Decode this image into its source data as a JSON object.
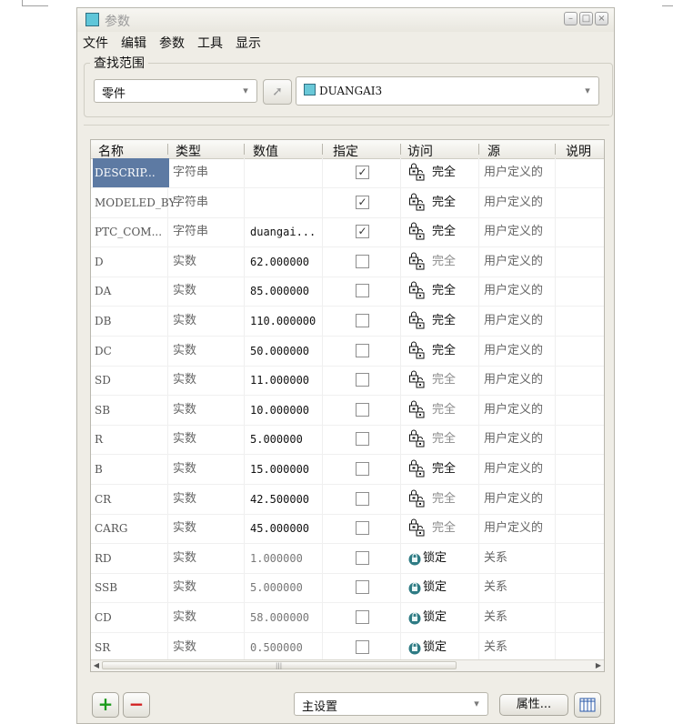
{
  "window": {
    "title": "参数",
    "titlebar_buttons": [
      "minimize",
      "maximize",
      "close"
    ]
  },
  "menu": [
    "文件",
    "编辑",
    "参数",
    "工具",
    "显示"
  ],
  "lookup": {
    "label": "查找范围",
    "scope": "零件",
    "model": "DUANGAI3"
  },
  "table": {
    "headers": [
      "名称",
      "类型",
      "数值",
      "指定",
      "访问",
      "源",
      "说明"
    ],
    "rows": [
      {
        "name": "DESCRIP...",
        "type": "字符串",
        "value": "",
        "designated": true,
        "access": "完全",
        "access_kind": "full",
        "source": "用户定义的",
        "selected": true
      },
      {
        "name": "MODELED_BY",
        "type": "字符串",
        "value": "",
        "designated": true,
        "access": "完全",
        "access_kind": "full",
        "source": "用户定义的"
      },
      {
        "name": "PTC_COM...",
        "type": "字符串",
        "value": "duangai...",
        "designated": true,
        "access": "完全",
        "access_kind": "full",
        "source": "用户定义的"
      },
      {
        "name": "D",
        "type": "实数",
        "value": "62.000000",
        "designated": false,
        "access": "完全",
        "access_kind": "full-dim",
        "source": "用户定义的"
      },
      {
        "name": "DA",
        "type": "实数",
        "value": "85.000000",
        "designated": false,
        "access": "完全",
        "access_kind": "full",
        "source": "用户定义的"
      },
      {
        "name": "DB",
        "type": "实数",
        "value": "110.000000",
        "designated": false,
        "access": "完全",
        "access_kind": "full",
        "source": "用户定义的"
      },
      {
        "name": "DC",
        "type": "实数",
        "value": "50.000000",
        "designated": false,
        "access": "完全",
        "access_kind": "full",
        "source": "用户定义的"
      },
      {
        "name": "SD",
        "type": "实数",
        "value": "11.000000",
        "designated": false,
        "access": "完全",
        "access_kind": "full-dim",
        "source": "用户定义的"
      },
      {
        "name": "SB",
        "type": "实数",
        "value": "10.000000",
        "designated": false,
        "access": "完全",
        "access_kind": "full-dim",
        "source": "用户定义的"
      },
      {
        "name": "R",
        "type": "实数",
        "value": "5.000000",
        "designated": false,
        "access": "完全",
        "access_kind": "full-dim",
        "source": "用户定义的"
      },
      {
        "name": "B",
        "type": "实数",
        "value": "15.000000",
        "designated": false,
        "access": "完全",
        "access_kind": "full",
        "source": "用户定义的"
      },
      {
        "name": "CR",
        "type": "实数",
        "value": "42.500000",
        "designated": false,
        "access": "完全",
        "access_kind": "full-dim",
        "source": "用户定义的"
      },
      {
        "name": "CARG",
        "type": "实数",
        "value": "45.000000",
        "designated": false,
        "access": "完全",
        "access_kind": "full-dim",
        "source": "用户定义的"
      },
      {
        "name": "RD",
        "type": "实数",
        "value": "1.000000",
        "designated": false,
        "access": "锁定",
        "access_kind": "locked",
        "source": "关系"
      },
      {
        "name": "SSB",
        "type": "实数",
        "value": "5.000000",
        "designated": false,
        "access": "锁定",
        "access_kind": "locked",
        "source": "关系"
      },
      {
        "name": "CD",
        "type": "实数",
        "value": "58.000000",
        "designated": false,
        "access": "锁定",
        "access_kind": "locked",
        "source": "关系"
      },
      {
        "name": "SR",
        "type": "实数",
        "value": "0.500000",
        "designated": false,
        "access": "锁定",
        "access_kind": "locked",
        "source": "关系"
      }
    ]
  },
  "footer": {
    "set": "主设置",
    "properties_label": "属性..."
  },
  "icons": {
    "add": "plus-icon",
    "remove": "minus-icon",
    "select": "arrow-cursor-icon",
    "part": "part-icon",
    "table_settings": "columns-icon",
    "access_full": "lock-group-icon",
    "access_locked": "padlock-icon"
  },
  "colors": {
    "selection": "#5d7aa3",
    "add": "#1b9a1b",
    "remove": "#d22020",
    "part_icon": "#69c8d8",
    "lock": "#2e7b84"
  }
}
